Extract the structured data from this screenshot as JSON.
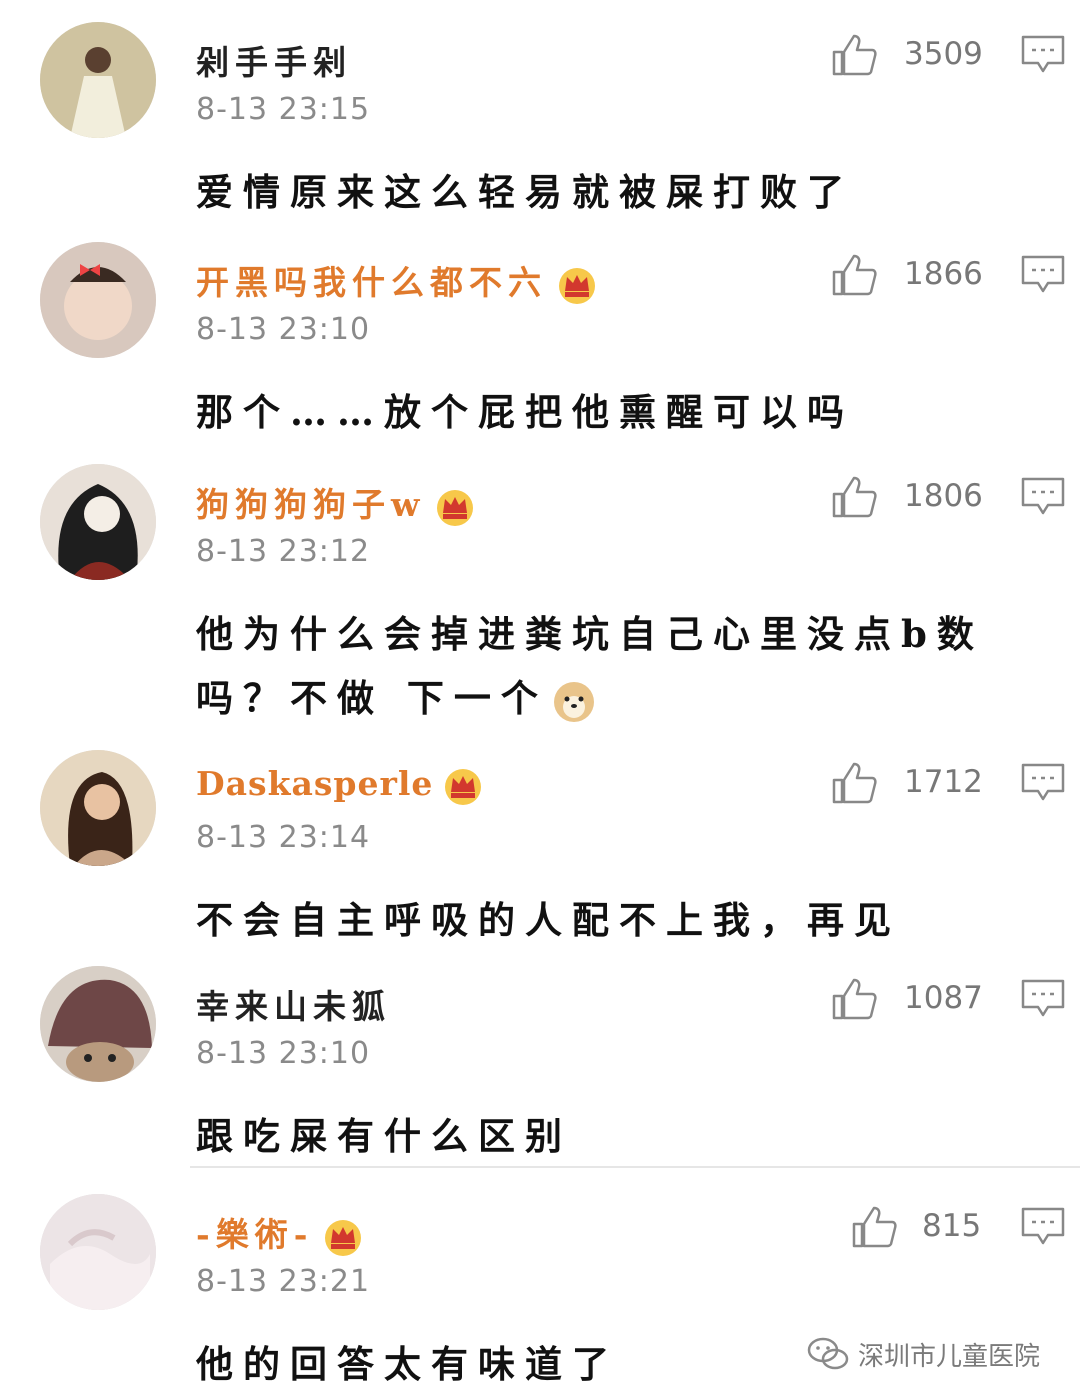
{
  "comments": [
    {
      "username": "剁手手剁",
      "vip": false,
      "time": "8-13 23:15",
      "likes": "3509",
      "text": "爱情原来这么轻易就被屎打败了",
      "avatar_icon": "girl-in-dress-avatar",
      "avatar_color": "#cfc3a0"
    },
    {
      "username": "开黑吗我什么都不六",
      "vip": true,
      "time": "8-13 23:10",
      "likes": "1866",
      "text": "那个……放个屁把他熏醒可以吗",
      "avatar_icon": "baby-with-bow-avatar",
      "avatar_color": "#d8c8be"
    },
    {
      "username": "狗狗狗狗子w",
      "vip": true,
      "time": "8-13 23:12",
      "likes": "1806",
      "text": "他为什么会掉进粪坑自己心里没点b数吗？不做 下一个",
      "avatar_icon": "illustrated-woman-avatar",
      "avatar_color": "#2b2b2b"
    },
    {
      "username": "Daskasperle",
      "vip": true,
      "time": "8-13 23:14",
      "likes": "1712",
      "text": "不会自主呼吸的人配不上我，再见",
      "avatar_icon": "woman-portrait-avatar",
      "avatar_color": "#caa78a"
    },
    {
      "username": "幸来山未狐",
      "vip": false,
      "time": "8-13 23:10",
      "likes": "1087",
      "text": "跟吃屎有什么区别",
      "avatar_icon": "cat-in-hat-avatar",
      "avatar_color": "#7a5555"
    },
    {
      "username": "-樂術-",
      "vip": true,
      "time": "8-13 23:21",
      "likes": "815",
      "text": "他的回答太有味道了",
      "avatar_icon": "hand-photo-avatar",
      "avatar_color": "#e8dde0"
    }
  ],
  "watermark": {
    "text": "深圳市儿童医院",
    "icon": "wechat-icon"
  },
  "colors": {
    "vip_name": "#e07a2c",
    "time": "#8a8a8a",
    "like": "#777777"
  }
}
